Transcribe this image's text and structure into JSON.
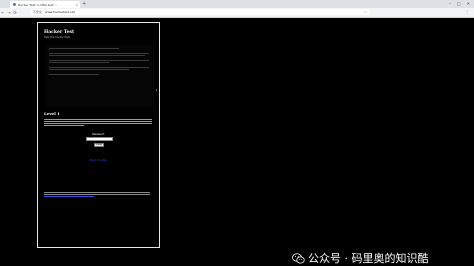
{
  "browser": {
    "tab_title": "Hacker Test: A little test ...",
    "tab_close": "×",
    "new_tab": "+",
    "window_controls": [
      "–",
      "□",
      "✕"
    ],
    "nav": {
      "back": "←",
      "forward": "→",
      "reload": "⟳"
    },
    "security_label": "不安全",
    "url": "www.hackertest.net",
    "star": "☆",
    "toolbar_icons": [
      "⋮"
    ]
  },
  "page": {
    "title": "Hacker Test",
    "subtitle": "Take the hacker test!",
    "level_heading": "Level 1",
    "password_label": "Password:",
    "submit_label": "Submit",
    "back_link": "Back to index"
  },
  "watermark": {
    "text": "公众号 · 码里奥的知识酷"
  }
}
